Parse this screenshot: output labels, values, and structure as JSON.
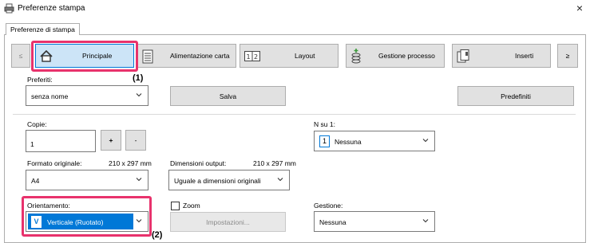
{
  "window": {
    "title": "Preferenze stampa",
    "close": "×"
  },
  "tab": {
    "label": "Preferenze di stampa"
  },
  "toolbar": {
    "prev": "≤",
    "next": "≥",
    "buttons": [
      {
        "label": "Principale",
        "icon": "home-icon"
      },
      {
        "label": "Alimentazione carta",
        "icon": "paper-tray-icon"
      },
      {
        "label": "Layout",
        "icon": "layout-icon"
      },
      {
        "label": "Gestione processo",
        "icon": "job-stack-icon"
      },
      {
        "label": "Inserti",
        "icon": "inserts-icon"
      }
    ]
  },
  "favorites": {
    "label": "Preferiti:",
    "value": "senza nome",
    "save": "Salva",
    "defaults": "Predefiniti"
  },
  "copies": {
    "label": "Copie:",
    "value": "1",
    "plus": "+",
    "minus": "-"
  },
  "nup": {
    "label": "N su 1:",
    "value": "Nessuna",
    "badge": "1"
  },
  "original_size": {
    "label": "Formato originale:",
    "dims": "210 x 297 mm",
    "value": "A4"
  },
  "output_size": {
    "label": "Dimensioni output:",
    "dims": "210 x 297 mm",
    "value": "Uguale a dimensioni originali"
  },
  "orientation": {
    "label": "Orientamento:",
    "value": "Verticale (Ruotato)",
    "badge": "V"
  },
  "zoom": {
    "label": "Zoom",
    "settings": "Impostazioni..."
  },
  "management": {
    "label": "Gestione:",
    "value": "Nessuna"
  },
  "callouts": {
    "one": "(1)",
    "two": "(2)"
  },
  "colors": {
    "highlight": "#e8326c",
    "selection": "#0078d7",
    "button_face": "#e1e1e1"
  }
}
